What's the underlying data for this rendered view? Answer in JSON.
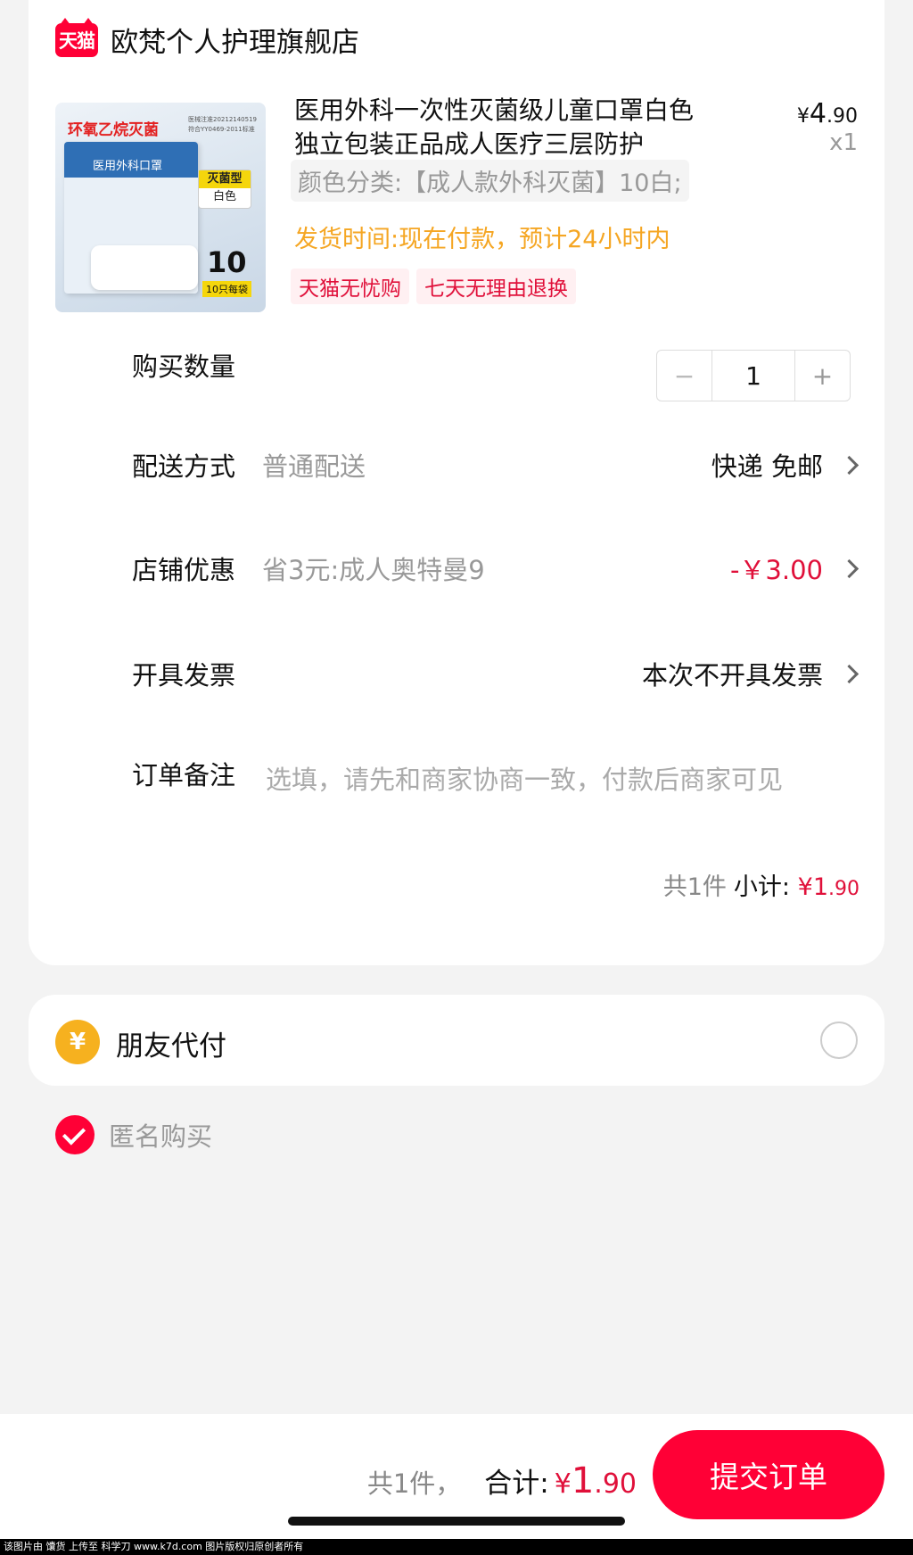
{
  "store": {
    "logo_text": "天猫",
    "name": "欧梵个人护理旗舰店"
  },
  "product": {
    "image_texts": {
      "banner": "环氧乙烷灭菌",
      "reg_line1": "医械注准20212140519",
      "reg_line2": "符合YY0469-2011标准",
      "box_title": "医用外科口罩",
      "tag_type": "灭菌型",
      "tag_color": "白色",
      "count": "10",
      "pack": "10只每袋"
    },
    "title": "医用外科一次性灭菌级儿童口罩白色独立包装正品成人医疗三层防护",
    "price_yen": "¥",
    "price_int": "4",
    "price_dec": ".90",
    "quantity_label": "x1",
    "spec": "颜色分类:【成人款外科灭菌】10白;",
    "ship_time": "发货时间:现在付款，预计24小时内",
    "badges": [
      "天猫无忧购",
      "七天无理由退换"
    ]
  },
  "rows": {
    "quantity": {
      "label": "购买数量",
      "minus": "−",
      "value": "1",
      "plus": "+"
    },
    "delivery": {
      "label": "配送方式",
      "sub": "普通配送",
      "value": "快递 免邮"
    },
    "discount": {
      "label": "店铺优惠",
      "sub": "省3元:成人奥特曼9",
      "value": "-￥3.00"
    },
    "invoice": {
      "label": "开具发票",
      "value": "本次不开具发票"
    },
    "note": {
      "label": "订单备注",
      "placeholder": "选填，请先和商家协商一致，付款后商家可见"
    }
  },
  "subtotal": {
    "count": "共1件",
    "label": "小计:",
    "yen": "¥",
    "int": "1",
    "dec": ".90"
  },
  "friend_pay": {
    "icon": "¥",
    "label": "朋友代付"
  },
  "anonymous": {
    "label": "匿名购买"
  },
  "bottom": {
    "count": "共1件，",
    "total_label": "合计:",
    "yen": "¥",
    "int": "1",
    "dec": ".90",
    "submit": "提交订单"
  },
  "watermark": "该图片由 馕货 上传至 科学刀 www.k7d.com 图片版权归原创者所有",
  "colors": {
    "accent": "#ff0036",
    "price_red": "#e0103a",
    "ship_orange": "#f5a623",
    "coin": "#f6b11f"
  }
}
